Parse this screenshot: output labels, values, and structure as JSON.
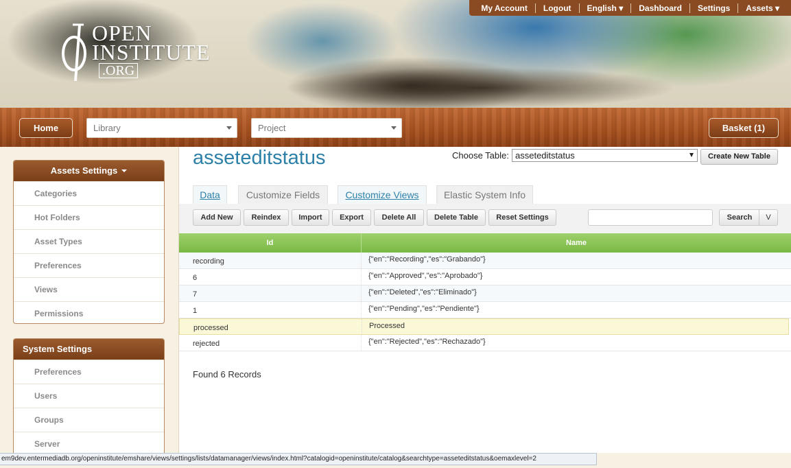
{
  "header": {
    "logo_line1": "OPEN",
    "logo_line2": "INSTITUTE",
    "logo_line3": ".ORG",
    "topnav": [
      "My Account",
      "Logout",
      "English ▾",
      "Dashboard",
      "Settings",
      "Assets ▾"
    ]
  },
  "woodbar": {
    "home": "Home",
    "library_placeholder": "Library",
    "project_placeholder": "Project",
    "basket": "Basket (1)"
  },
  "sidebar": {
    "assets_title": "Assets Settings",
    "assets_items": [
      "Categories",
      "Hot Folders",
      "Asset Types",
      "Preferences",
      "Views",
      "Permissions"
    ],
    "system_title": "System Settings",
    "system_items": [
      "Preferences",
      "Users",
      "Groups",
      "Server"
    ]
  },
  "main": {
    "title": "asseteditstatus",
    "choose_label": "Choose Table:",
    "choose_value": "asseteditstatus",
    "create_table": "Create New Table",
    "tabs": [
      "Data",
      "Customize Fields",
      "Customize Views",
      "Elastic System Info"
    ],
    "toolbar": [
      "Add New",
      "Reindex",
      "Import",
      "Export",
      "Delete All",
      "Delete Table",
      "Reset Settings"
    ],
    "search": "Search",
    "search_toggle": "V",
    "columns": [
      "Id",
      "Name"
    ],
    "rows": [
      {
        "id": "recording",
        "name": "{\"en\":\"Recording\",\"es\":\"Grabando\"}"
      },
      {
        "id": "6",
        "name": "{\"en\":\"Approved\",\"es\":\"Aprobado\"}"
      },
      {
        "id": "7",
        "name": "{\"en\":\"Deleted\",\"es\":\"Eliminado\"}"
      },
      {
        "id": "1",
        "name": "{\"en\":\"Pending\",\"es\":\"Pendiente\"}"
      },
      {
        "id": "processed",
        "name": "Processed"
      },
      {
        "id": "rejected",
        "name": "{\"en\":\"Rejected\",\"es\":\"Rechazado\"}"
      }
    ],
    "records": "Found 6 Records"
  },
  "statusbar": {
    "url": "em9dev.entermediadb.org/openinstitute/emshare/views/settings/lists/datamanager/views/index.html?catalogid=openinstitute/catalog&searchtype=asseteditstatus&oemaxlevel=2"
  }
}
